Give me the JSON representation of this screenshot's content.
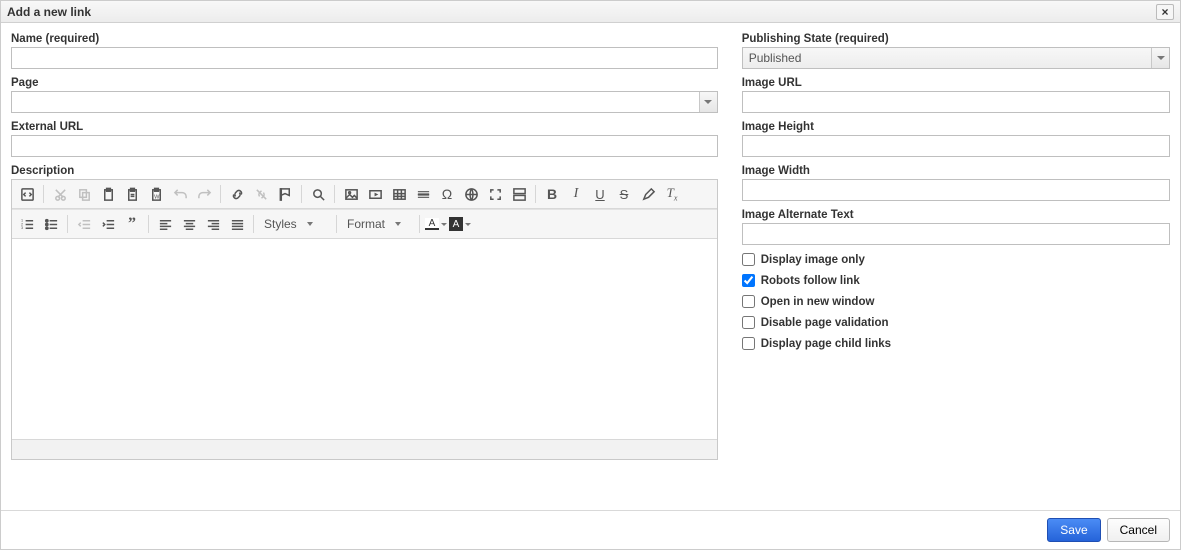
{
  "dialog": {
    "title": "Add a new link",
    "close": "×"
  },
  "left": {
    "name_label": "Name (required)",
    "name_value": "",
    "page_label": "Page",
    "page_value": "",
    "external_url_label": "External URL",
    "external_url_value": "",
    "description_label": "Description"
  },
  "toolbar": {
    "styles": "Styles",
    "format": "Format"
  },
  "right": {
    "state_label": "Publishing State (required)",
    "state_value": "Published",
    "image_url_label": "Image URL",
    "image_url_value": "",
    "image_height_label": "Image Height",
    "image_height_value": "",
    "image_width_label": "Image Width",
    "image_width_value": "",
    "image_alt_label": "Image Alternate Text",
    "image_alt_value": "",
    "cb_display_image": "Display image only",
    "cb_robots": "Robots follow link",
    "cb_newwin": "Open in new window",
    "cb_disable_val": "Disable page validation",
    "cb_child_links": "Display page child links"
  },
  "checkboxes": {
    "display_image": false,
    "robots": true,
    "newwin": false,
    "disable_val": false,
    "child_links": false
  },
  "footer": {
    "save": "Save",
    "cancel": "Cancel"
  }
}
